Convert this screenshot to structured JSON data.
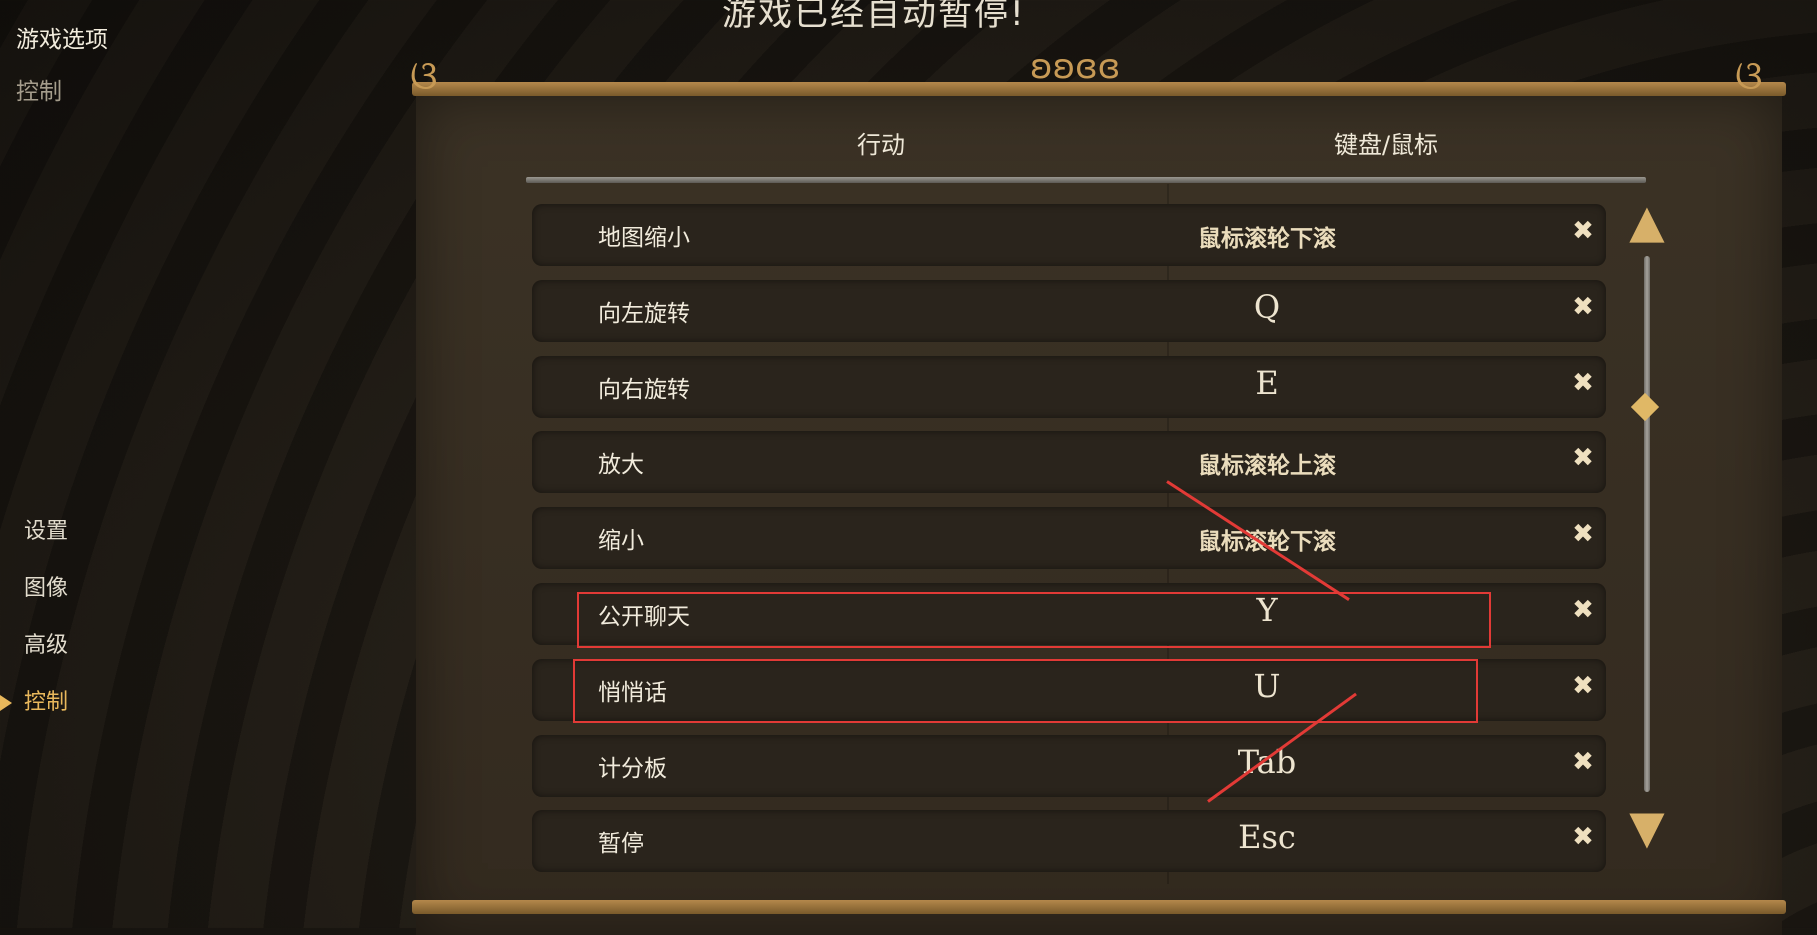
{
  "pause_banner": "游戏已经自动暂停!",
  "top_menu": {
    "game_options": "游戏选项",
    "controls": "控制"
  },
  "side_nav": [
    {
      "label": "设置",
      "active": false
    },
    {
      "label": "图像",
      "active": false
    },
    {
      "label": "高级",
      "active": false
    },
    {
      "label": "控制",
      "active": true
    }
  ],
  "table": {
    "header_action": "行动",
    "header_key": "键盘/鼠标",
    "rows": [
      {
        "action": "地图缩小",
        "key": "鼠标滚轮下滚",
        "delete": "✖"
      },
      {
        "action": "向左旋转",
        "key": "Q",
        "delete": "✖"
      },
      {
        "action": "向右旋转",
        "key": "E",
        "delete": "✖"
      },
      {
        "action": "放大",
        "key": "鼠标滚轮上滚",
        "delete": "✖"
      },
      {
        "action": "缩小",
        "key": "鼠标滚轮下滚",
        "delete": "✖"
      },
      {
        "action": "公开聊天",
        "key": "Y",
        "delete": "✖"
      },
      {
        "action": "悄悄话",
        "key": "U",
        "delete": "✖"
      },
      {
        "action": "计分板",
        "key": "Tab",
        "delete": "✖"
      },
      {
        "action": "暂停",
        "key": "Esc",
        "delete": "✖"
      }
    ]
  },
  "colors": {
    "accent": "#e9b85c",
    "highlight": "#e23a36",
    "panel": "#3b3225"
  },
  "icons": {
    "scroll_up": "arrow-up-icon",
    "scroll_down": "arrow-down-icon",
    "delete": "close-icon"
  }
}
